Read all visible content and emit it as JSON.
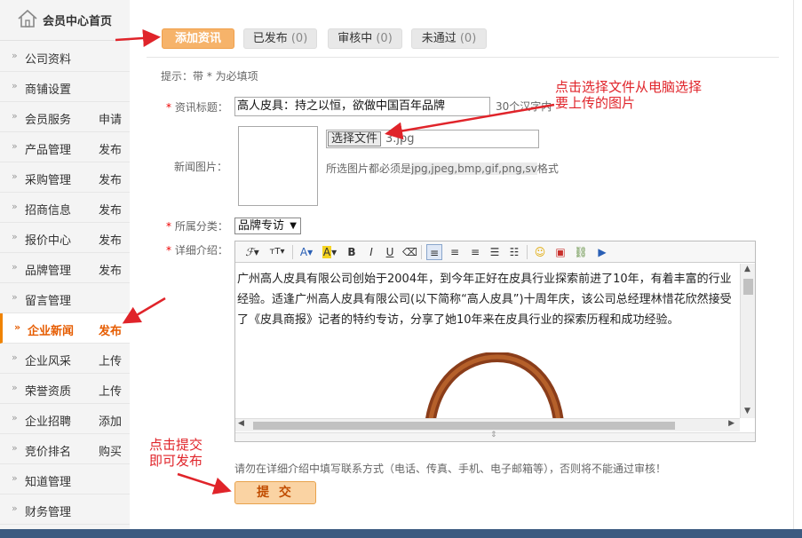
{
  "sidebar": {
    "home_label": "会员中心首页",
    "items": [
      {
        "label": "公司资料",
        "action": ""
      },
      {
        "label": "商铺设置",
        "action": ""
      },
      {
        "label": "会员服务",
        "action": "申请"
      },
      {
        "label": "产品管理",
        "action": "发布"
      },
      {
        "label": "采购管理",
        "action": "发布"
      },
      {
        "label": "招商信息",
        "action": "发布"
      },
      {
        "label": "报价中心",
        "action": "发布"
      },
      {
        "label": "品牌管理",
        "action": "发布"
      },
      {
        "label": "留言管理",
        "action": ""
      },
      {
        "label": "企业新闻",
        "action": "发布"
      },
      {
        "label": "企业风采",
        "action": "上传"
      },
      {
        "label": "荣誉资质",
        "action": "上传"
      },
      {
        "label": "企业招聘",
        "action": "添加"
      },
      {
        "label": "竞价排名",
        "action": "购买"
      },
      {
        "label": "知道管理",
        "action": ""
      },
      {
        "label": "财务管理",
        "action": ""
      }
    ]
  },
  "tabs": [
    {
      "label": "添加资讯",
      "count": ""
    },
    {
      "label": "已发布",
      "count": "(0)"
    },
    {
      "label": "审核中",
      "count": "(0)"
    },
    {
      "label": "未通过",
      "count": "(0)"
    }
  ],
  "form": {
    "hint": "提示：带 * 为必填项",
    "required_mark": "*",
    "title_label": "资讯标题：",
    "title_value": "高人皮具：持之以恒，欲做中国百年品牌",
    "title_limit": "30个汉字内",
    "image_label": "新闻图片：",
    "file_button": "选择文件",
    "file_name": "3.jpg",
    "image_note": "所选图片都必须是",
    "image_formats": "jpg,jpeg,bmp,gif,png,sv",
    "image_note_end": "格式",
    "category_label": "所属分类：",
    "category_value": "品牌专访",
    "detail_label": "详细介绍：",
    "warning": "请勿在详细介绍中填写联系方式（电话、传真、手机、电子邮箱等），否则将不能通过审核！",
    "submit": "提 交"
  },
  "editor": {
    "paragraph": "广州高人皮具有限公司创始于2004年，到今年正好在皮具行业探索前进了10年，有着丰富的行业经验。适逢广州高人皮具有限公司(以下简称“高人皮具”)十周年庆，该公司总经理林惜花欣然接受了《皮具商报》记者的特约专访，分享了她10年来在皮具行业的探索历程和成功经验。",
    "toolbar_bold": "B",
    "toolbar_italic": "I",
    "toolbar_underline": "U",
    "toolbar_font_color": "A",
    "toolbar_highlight": "A"
  },
  "annotations": {
    "choose_file": "点击选择文件从电脑选择\n要上传的图片",
    "submit_hint": "点击提交\n即可发布"
  },
  "colors": {
    "accent": "#f6b36a",
    "active_text": "#e65c00",
    "annotation_red": "#e0242a"
  }
}
